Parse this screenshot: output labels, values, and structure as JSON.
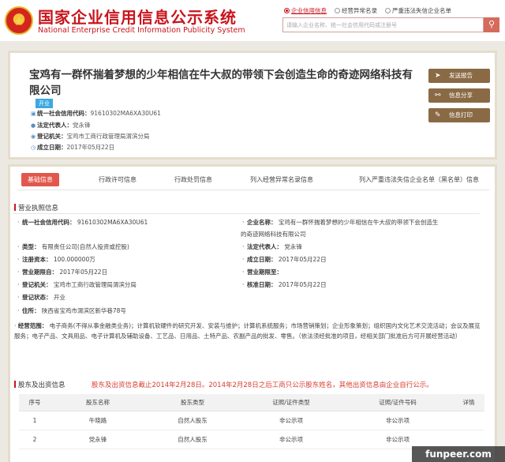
{
  "header": {
    "title": "国家企业信用信息公示系统",
    "subtitle": "National Enterprise Credit Information Publicity System",
    "nav": [
      "企业信用信息",
      "经营异常名录",
      "严重违法失信企业名单"
    ],
    "search_placeholder": "请输入企业名称、统一社会信用代码或注册号",
    "search_icon": "search-icon"
  },
  "company": {
    "name": "宝鸡有一群怀揣着梦想的少年相信在牛大叔的带领下会创造生命的奇迹网络科技有限公司",
    "status_badge": "开业",
    "credit_code_label": "统一社会信用代码：",
    "credit_code": "91610302MA6XA30U61",
    "legal_rep_label": "法定代表人：",
    "legal_rep": "党永锋",
    "reg_authority_label": "登记机关：",
    "reg_authority": "宝鸡市工商行政管理局渭滨分局",
    "founded_label": "成立日期：",
    "founded": "2017年05月22日"
  },
  "actions": {
    "report": "发送报告",
    "share": "信息分享",
    "print": "信息打印"
  },
  "tabs": [
    "基础信息",
    "行政许可信息",
    "行政处罚信息",
    "列入经营异常名录信息",
    "列入严重违法失信企业名单（黑名单）信息"
  ],
  "license": {
    "section_title": "营业执照信息",
    "credit_code_label": "统一社会信用代码：",
    "credit_code": "91610302MA6XA30U61",
    "name_label": "企业名称：",
    "name_line1": "宝鸡有一群怀揣着梦想的少年相信在牛大叔的带领下会创造生",
    "name_line2": "的奇迹网络科技有限公司",
    "type_label": "类型：",
    "type": "有限责任公司(自然人投资或控股)",
    "legal_rep_label": "法定代表人：",
    "legal_rep": "党永锋",
    "capital_label": "注册资本：",
    "capital": "100.000000万",
    "founded_label": "成立日期：",
    "founded": "2017年05月22日",
    "term_from_label": "营业期限自：",
    "term_from": "2017年05月22日",
    "term_to_label": "营业期限至：",
    "term_to": "",
    "authority_label": "登记机关：",
    "authority": "宝鸡市工商行政管理局渭滨分局",
    "approval_label": "核准日期：",
    "approval": "2017年05月22日",
    "status_label": "登记状态：",
    "status": "开业",
    "address_label": "住所：",
    "address": "陕西省宝鸡市渭滨区新华巷78号",
    "scope_label": "经营范围：",
    "scope": "电子商务(不得从事金融类业务)；计算机软硬件的研究开发、安装与维护；计算机系统服务；市场营销策划；企业形象策划；组织国内文化艺术交流活动；会议及展览服务；电子产品、文具用品、电子计算机及辅助设备、工艺品、日用品、土特产品、农副产品的批发、零售。（依法须经批准的项目，经相关部门批准后方可开展经营活动）"
  },
  "shareholders": {
    "section_title": "股东及出资信息",
    "note": "股东及出资信息截止2014年2月28日。2014年2月28日之后工商只公示股东姓名，其他出资信息由企业自行公示。",
    "columns": [
      "序号",
      "股东名称",
      "股东类型",
      "证照/证件类型",
      "证照/证件号码",
      "详情"
    ],
    "rows": [
      [
        "1",
        "牛晓路",
        "自然人股东",
        "非公示项",
        "非公示项",
        ""
      ],
      [
        "2",
        "党永锋",
        "自然人股东",
        "非公示项",
        "非公示项",
        ""
      ]
    ]
  },
  "watermark": "funpeer.com",
  "colors": {
    "brand_red": "#c8151d",
    "tab_active": "#e2574c",
    "action_brown": "#8a6a45",
    "badge_blue": "#3aa8e0"
  }
}
